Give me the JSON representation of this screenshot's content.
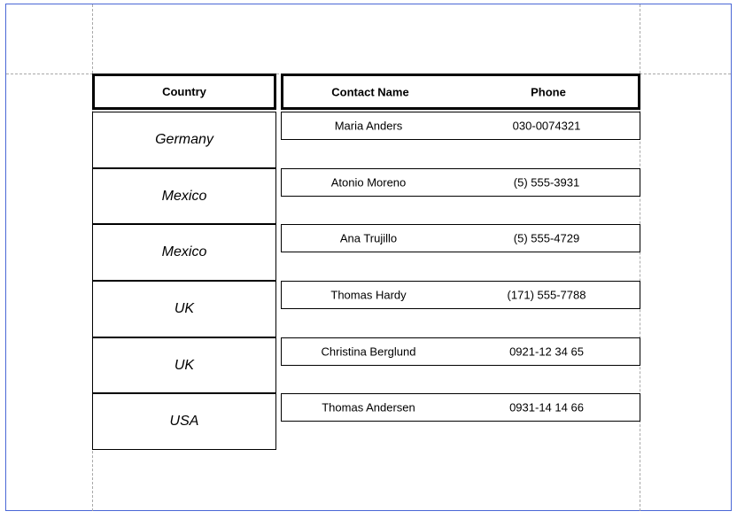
{
  "report": {
    "headers": {
      "country": "Country",
      "contact_name": "Contact Name",
      "phone": "Phone"
    },
    "rows": [
      {
        "country": "Germany",
        "contact_name": "Maria Anders",
        "phone": "030-0074321"
      },
      {
        "country": "Mexico",
        "contact_name": "Atonio Moreno",
        "phone": "(5) 555-3931"
      },
      {
        "country": "Mexico",
        "contact_name": "Ana Trujillo",
        "phone": "(5) 555-4729"
      },
      {
        "country": "UK",
        "contact_name": "Thomas Hardy",
        "phone": "(171) 555-7788"
      },
      {
        "country": "UK",
        "contact_name": "Christina Berglund",
        "phone": "0921-12 34 65"
      },
      {
        "country": "USA",
        "contact_name": "Thomas Andersen",
        "phone": "0931-14 14 66"
      }
    ]
  },
  "colors": {
    "page_border": "#4a67d6",
    "guide_line": "#a8a8a8",
    "cell_border": "#000000"
  }
}
